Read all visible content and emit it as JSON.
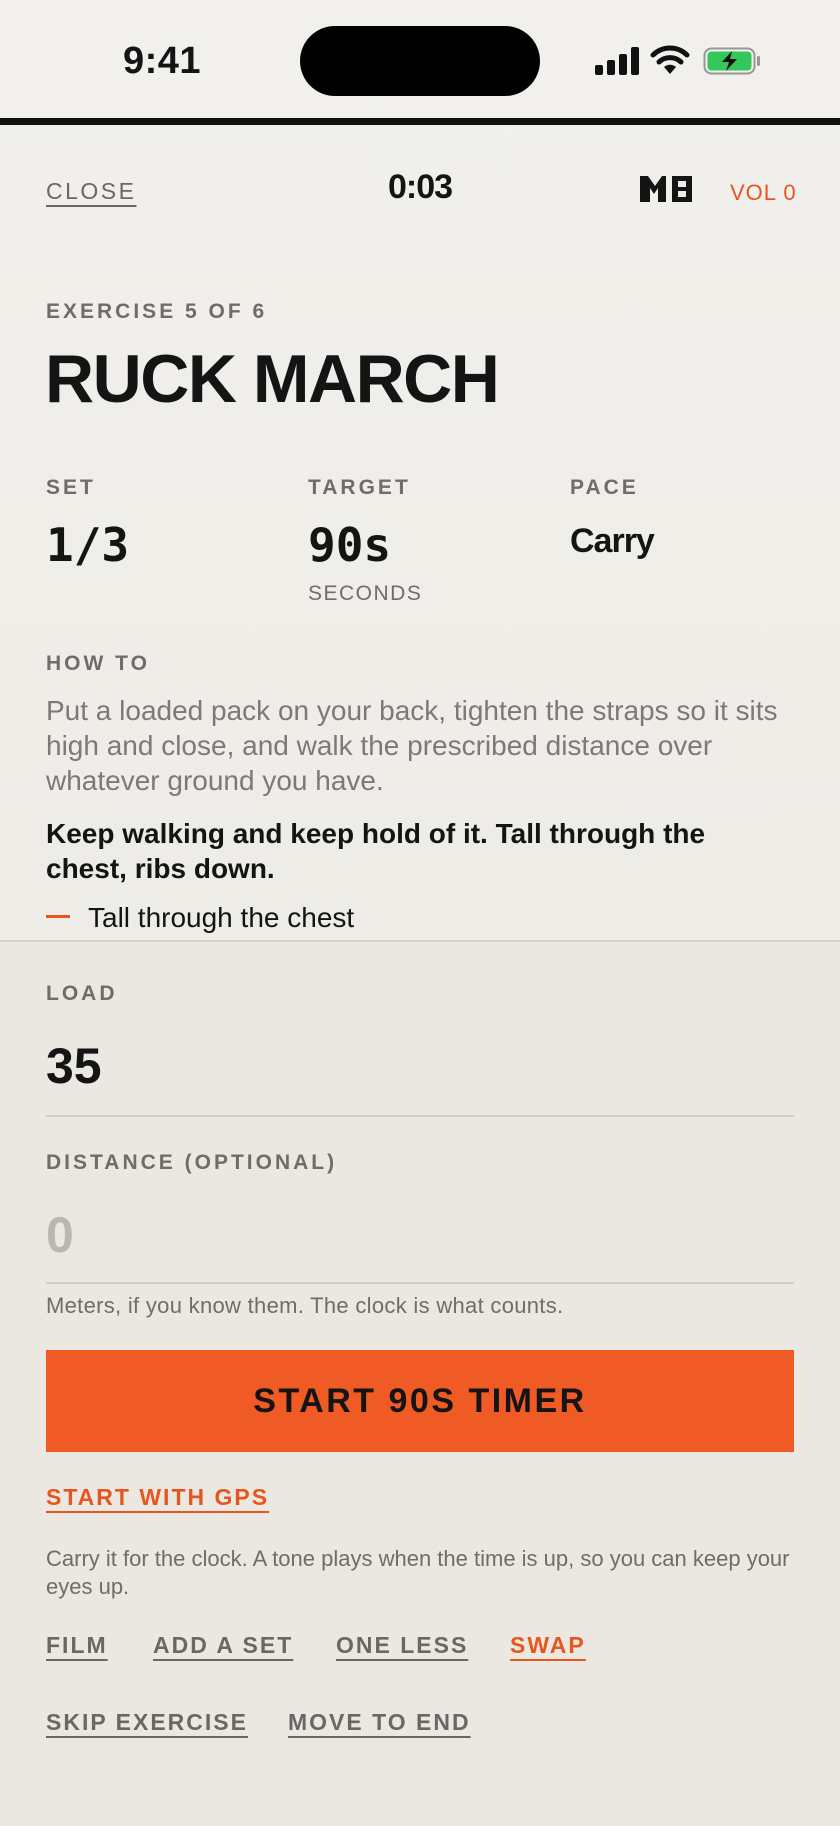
{
  "status_bar": {
    "time": "9:41"
  },
  "header": {
    "close_label": "CLOSE",
    "clock": "0:03",
    "logo_icon": "brand-logo-icon",
    "volume_label": "VOL 0"
  },
  "exercise": {
    "counter": "EXERCISE 5 OF 6",
    "name": "RUCK MARCH"
  },
  "stats": [
    {
      "label": "SET",
      "value": "1/3",
      "sub": ""
    },
    {
      "label": "TARGET",
      "value": "90s",
      "sub": "SECONDS"
    },
    {
      "label": "PACE",
      "value": "Carry",
      "sub": ""
    }
  ],
  "how_to": {
    "label": "HOW TO",
    "description": "Put a loaded pack on your back, tighten the straps so it sits high and close, and walk the prescribed distance over whatever ground you have.",
    "emphasis": "Keep walking and keep hold of it. Tall through the chest, ribs down.",
    "cue": "Tall through the chest"
  },
  "load": {
    "label": "LOAD",
    "value": "35"
  },
  "distance": {
    "label": "DISTANCE (OPTIONAL)",
    "placeholder": "0",
    "hint": "Meters, if you know them. The clock is what counts."
  },
  "primary_action": {
    "label": "START 90S TIMER"
  },
  "gps_action": {
    "label": "START WITH GPS"
  },
  "timer_note": "Carry it for the clock. A tone plays when the time is up, so you can keep your eyes up.",
  "actions": {
    "film": "FILM",
    "add_set": "ADD A SET",
    "one_less": "ONE LESS",
    "swap": "SWAP",
    "skip": "SKIP EXERCISE",
    "move_to_end": "MOVE TO END"
  },
  "colors": {
    "accent": "#f05a24",
    "accent_text": "#e8561f",
    "background": "#ece9e3",
    "battery": "#34c759"
  }
}
